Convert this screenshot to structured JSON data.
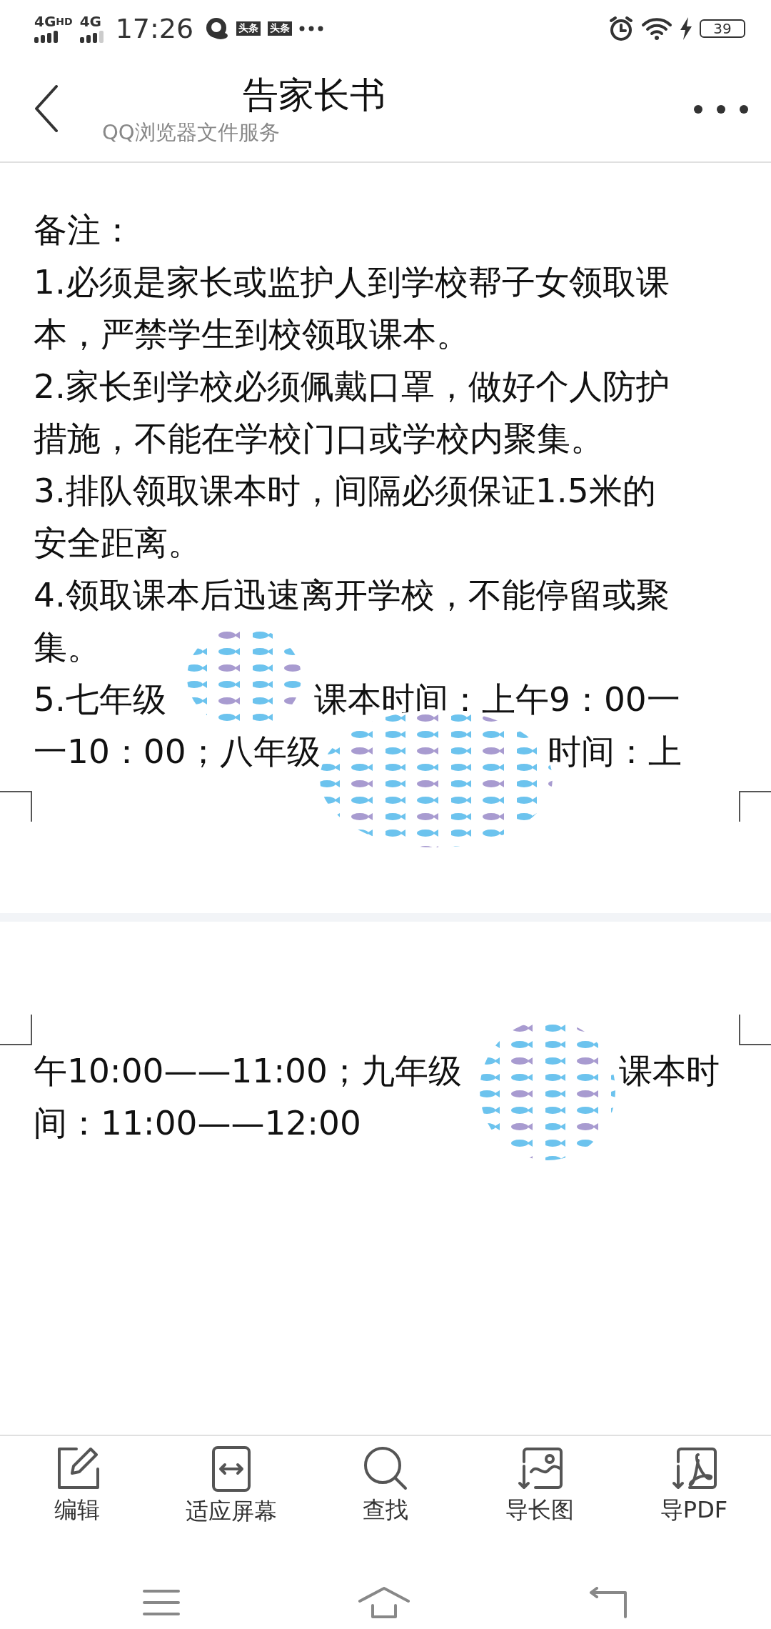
{
  "status_bar": {
    "network_1": "4G",
    "network_1_badge": "HD",
    "network_2": "4G",
    "time": "17:26",
    "notification_badges": [
      "头条",
      "头条"
    ],
    "battery": "39"
  },
  "header": {
    "title": "告家长书",
    "subtitle": "QQ浏览器文件服务"
  },
  "pages": [
    {
      "lines": [
        {
          "segments": [
            "备注："
          ]
        },
        {
          "segments": [
            "1.必须是家长或监护人到学校帮子女领取课"
          ]
        },
        {
          "segments": [
            "本，严禁学生到校领取课本。"
          ]
        },
        {
          "segments": [
            "2.家长到学校必须佩戴口罩，做好个人防护"
          ]
        },
        {
          "segments": [
            "措施，不能在学校门口或学校内聚集。"
          ]
        },
        {
          "segments": [
            "3.排队领取课本时，间隔必须保证1.5米的"
          ]
        },
        {
          "segments": [
            "安全距离。"
          ]
        },
        {
          "segments": [
            "4.领取课本后迅速离开学校，不能停留或聚"
          ]
        },
        {
          "segments": [
            "集。"
          ]
        },
        {
          "segments": [
            "5.七年级",
            "课本时间：上午9：00一"
          ]
        },
        {
          "segments": [
            "一10：00；八年级",
            "时间：上"
          ]
        }
      ]
    },
    {
      "lines": [
        {
          "segments": [
            "午10:00——11:00；九年级",
            "课本时"
          ]
        },
        {
          "segments": [
            "间：11:00——12:00"
          ]
        }
      ]
    }
  ],
  "toolbar": [
    {
      "kind": "edit",
      "label": "编辑"
    },
    {
      "kind": "fit",
      "label": "适应屏幕"
    },
    {
      "kind": "find",
      "label": "查找"
    },
    {
      "kind": "long-image",
      "label": "导长图"
    },
    {
      "kind": "pdf",
      "label": "导PDF"
    }
  ]
}
